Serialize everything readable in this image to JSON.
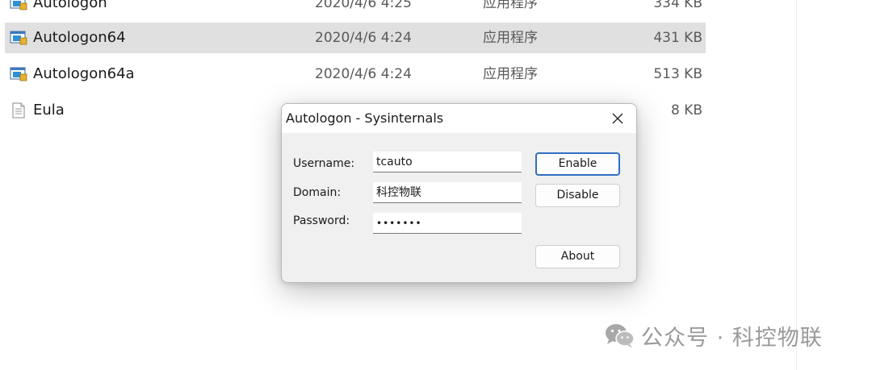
{
  "files": [
    {
      "name": "Autologon",
      "date": "2020/4/6 4:25",
      "type": "应用程序",
      "size": "334 KB",
      "icon": "app-icon"
    },
    {
      "name": "Autologon64",
      "date": "2020/4/6 4:24",
      "type": "应用程序",
      "size": "431 KB",
      "icon": "app-icon",
      "selected": true
    },
    {
      "name": "Autologon64a",
      "date": "2020/4/6 4:24",
      "type": "应用程序",
      "size": "513 KB",
      "icon": "app-icon"
    },
    {
      "name": "Eula",
      "date": "",
      "type": "",
      "size": "8 KB",
      "icon": "text-file-icon"
    }
  ],
  "dialog": {
    "title": "Autologon - Sysinternals",
    "close_icon": "close-icon",
    "fields": {
      "username": {
        "label": "Username:",
        "value": "tcauto"
      },
      "domain": {
        "label": "Domain:",
        "value": "科控物联"
      },
      "password": {
        "label": "Password:",
        "value": "•••••••"
      }
    },
    "buttons": {
      "enable": "Enable",
      "disable": "Disable",
      "about": "About"
    }
  },
  "watermark": {
    "icon": "wechat-icon",
    "text": "公众号 · 科控物联"
  },
  "colors": {
    "selection": "#e0e0e0",
    "dialog_bg": "#f0f0f0",
    "default_button_border": "#2f6fc4",
    "watermark_text": "#9a9a9a"
  }
}
